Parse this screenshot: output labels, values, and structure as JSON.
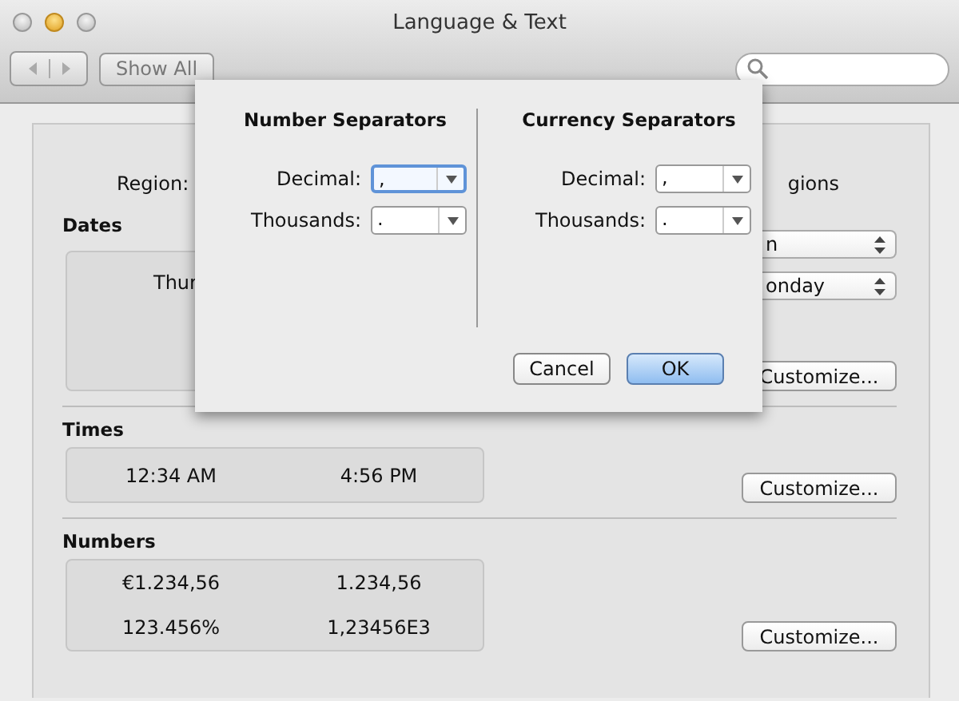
{
  "window": {
    "title": "Language & Text"
  },
  "toolbar": {
    "show_all": "Show All"
  },
  "background": {
    "region_label": "Region:",
    "region_cut": "gions",
    "dates": {
      "label": "Dates",
      "cut_text": "Thur",
      "calendar_cut": "n",
      "week_cut": "onday",
      "button": "Customize..."
    },
    "times": {
      "label": "Times",
      "values": [
        "12:34 AM",
        "4:56 PM"
      ],
      "button": "Customize..."
    },
    "numbers": {
      "label": "Numbers",
      "values": [
        "€1.234,56",
        "1.234,56",
        "123.456%",
        "1,23456E3"
      ],
      "button": "Customize..."
    }
  },
  "sheet": {
    "columns": [
      {
        "title": "Number Separators",
        "fields": [
          {
            "label": "Decimal:",
            "value": ",",
            "focused": true
          },
          {
            "label": "Thousands:",
            "value": ".",
            "focused": false
          }
        ]
      },
      {
        "title": "Currency Separators",
        "fields": [
          {
            "label": "Decimal:",
            "value": ",",
            "focused": false
          },
          {
            "label": "Thousands:",
            "value": ".",
            "focused": false
          }
        ]
      }
    ],
    "buttons": [
      {
        "label": "Cancel",
        "default": false
      },
      {
        "label": "OK",
        "default": true
      }
    ]
  }
}
